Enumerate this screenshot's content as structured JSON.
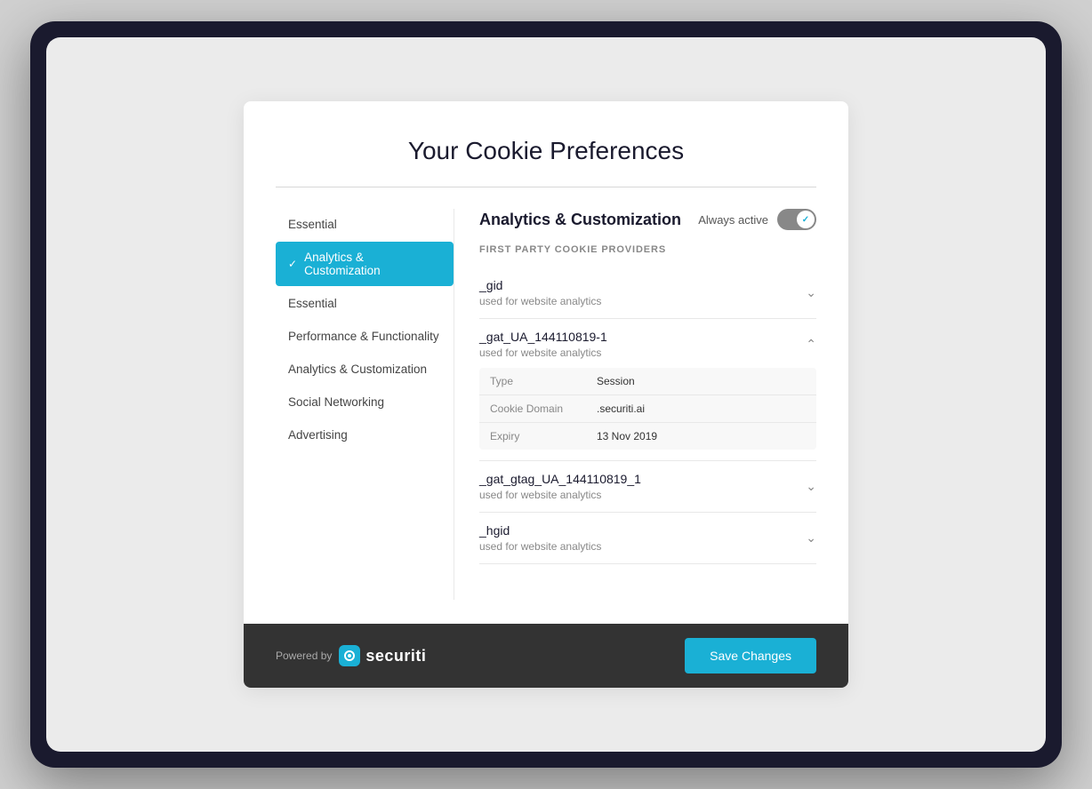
{
  "page": {
    "background": "#ebebeb"
  },
  "modal": {
    "title": "Your Cookie Preferences"
  },
  "sidebar": {
    "items": [
      {
        "id": "essential-top",
        "label": "Essential",
        "active": false
      },
      {
        "id": "analytics-customization-active",
        "label": "Analytics & Customization",
        "active": true
      },
      {
        "id": "essential",
        "label": "Essential",
        "active": false
      },
      {
        "id": "performance-functionality",
        "label": "Performance & Functionality",
        "active": false
      },
      {
        "id": "analytics-customization",
        "label": "Analytics & Customization",
        "active": false
      },
      {
        "id": "social-networking",
        "label": "Social Networking",
        "active": false
      },
      {
        "id": "advertising",
        "label": "Advertising",
        "active": false
      }
    ]
  },
  "main": {
    "section_title": "Analytics & Customization",
    "always_active_label": "Always active",
    "providers_label": "FIRST PARTY COOKIE PROVIDERS",
    "cookies": [
      {
        "name": "_gid",
        "description": "used for website analytics",
        "expanded": false,
        "details": []
      },
      {
        "name": "_gat_UA_144110819-1",
        "description": "used for website analytics",
        "expanded": true,
        "details": [
          {
            "key": "Type",
            "value": "Session"
          },
          {
            "key": "Cookie Domain",
            "value": ".securiti.ai"
          },
          {
            "key": "Expiry",
            "value": "13 Nov 2019"
          }
        ]
      },
      {
        "name": "_gat_gtag_UA_144110819_1",
        "description": "used for website analytics",
        "expanded": false,
        "details": []
      },
      {
        "name": "_hgid",
        "description": "used for website analytics",
        "expanded": false,
        "details": []
      }
    ]
  },
  "footer": {
    "powered_by": "Powered by",
    "brand_name": "securiti",
    "save_button_label": "Save Changes"
  }
}
